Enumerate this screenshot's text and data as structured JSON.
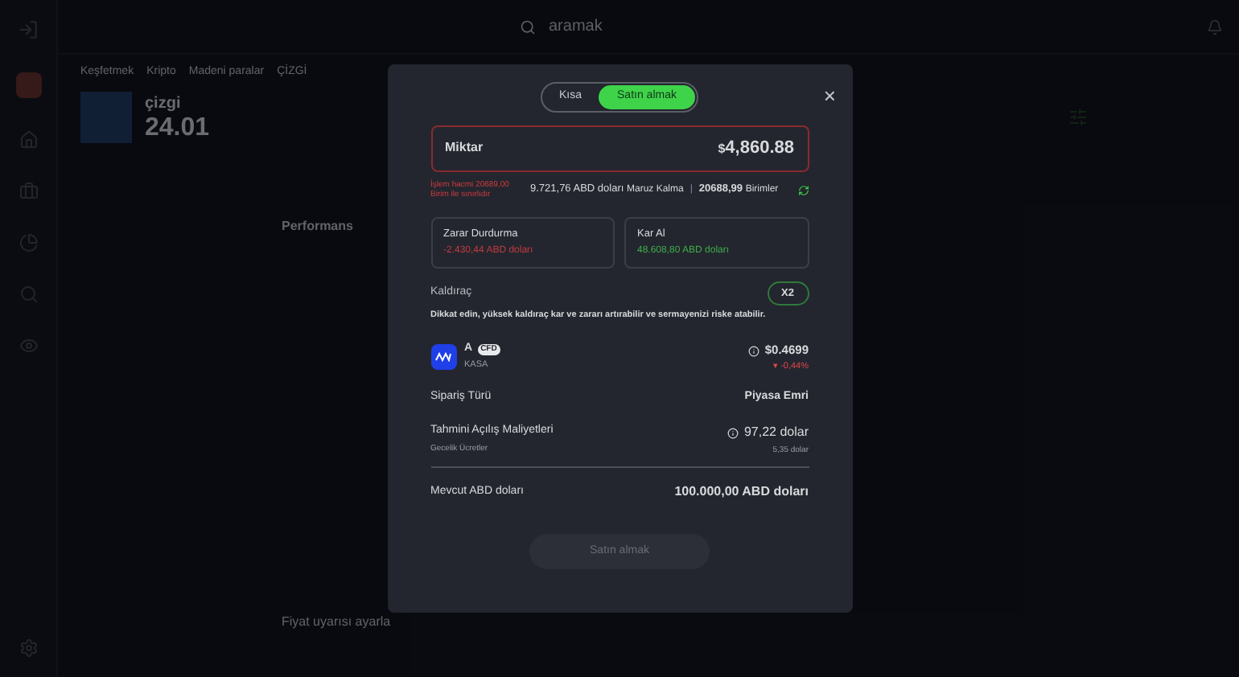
{
  "search": {
    "placeholder": "aramak"
  },
  "breadcrumb": [
    "Keşfetmek",
    "Kripto",
    "Madeni paralar",
    "ÇİZGİ"
  ],
  "asset_header": {
    "name": "çizgi",
    "price": "24.01"
  },
  "background_sections": [
    "Performans",
    "Fiyat uyarısı ayarla"
  ],
  "order_dialog": {
    "tabs": [
      {
        "label": "Kısa",
        "selected": false
      },
      {
        "label": "Satın almak",
        "selected": true
      }
    ],
    "close": "×",
    "amount": {
      "label": "Miktar",
      "currency": "$",
      "value": "4,860.88",
      "error": true
    },
    "limit_warning": "İşlem hacmi 20689,00 Birim ile sınırlıdır",
    "exposure": "9.721,76 ABD doları",
    "exposure_label": "Maruz Kalma",
    "separator": "|",
    "units": "20688,99",
    "units_label": "Birimler",
    "stop_loss": {
      "label": "Zarar Durdurma",
      "value": "-2.430,44 ABD doları"
    },
    "take_profit": {
      "label": "Kar Al",
      "value": "48.608,80 ABD doları"
    },
    "leverage": {
      "label": "Kaldıraç",
      "value": "X2"
    },
    "leverage_warning": "Dikkat edin, yüksek kaldıraç kar ve zararı artırabilir ve sermayenizi riske atabilir.",
    "instrument": {
      "name": "A",
      "badge": "CFD",
      "ticker": "KASA",
      "price": "$0.4699",
      "change_arrow": "▾",
      "change": "-0,44%"
    },
    "order_type": {
      "label": "Sipariş Türü",
      "value": "Piyasa Emri"
    },
    "costs": {
      "label": "Tahmini Açılış Maliyetleri",
      "sublabel": "Gecelik Ücretler",
      "value": "97,22 dolar",
      "subvalue": "5,35 dolar"
    },
    "available": {
      "label": "Mevcut ABD doları",
      "value": "100.000,00 ABD doları"
    },
    "submit": {
      "label": "Satın almak",
      "disabled": true
    }
  }
}
